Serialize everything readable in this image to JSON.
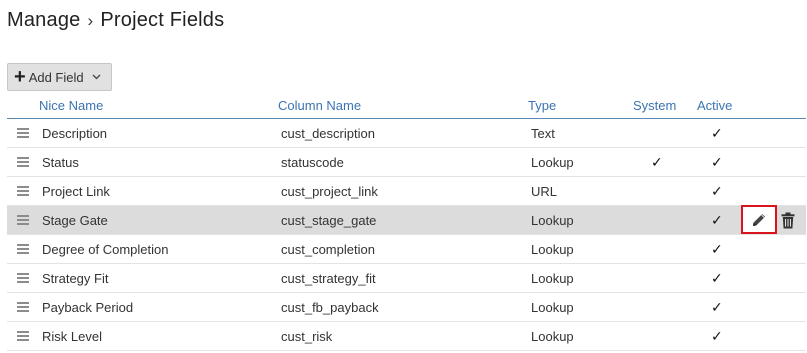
{
  "breadcrumb": {
    "parent": "Manage",
    "separator": "›",
    "current": "Project Fields"
  },
  "toolbar": {
    "add_label": "Add Field"
  },
  "table": {
    "headers": {
      "nice_name": "Nice Name",
      "column_name": "Column Name",
      "type": "Type",
      "system": "System",
      "active": "Active"
    },
    "check_glyph": "✓",
    "rows": [
      {
        "nice_name": "Description",
        "column_name": "cust_description",
        "type": "Text",
        "system": "",
        "active": "✓"
      },
      {
        "nice_name": "Status",
        "column_name": "statuscode",
        "type": "Lookup",
        "system": "✓",
        "active": "✓"
      },
      {
        "nice_name": "Project Link",
        "column_name": "cust_project_link",
        "type": "URL",
        "system": "",
        "active": "✓"
      },
      {
        "nice_name": "Stage Gate",
        "column_name": "cust_stage_gate",
        "type": "Lookup",
        "system": "",
        "active": "✓"
      },
      {
        "nice_name": "Degree of Completion",
        "column_name": "cust_completion",
        "type": "Lookup",
        "system": "",
        "active": "✓"
      },
      {
        "nice_name": "Strategy Fit",
        "column_name": "cust_strategy_fit",
        "type": "Lookup",
        "system": "",
        "active": "✓"
      },
      {
        "nice_name": "Payback Period",
        "column_name": "cust_fb_payback",
        "type": "Lookup",
        "system": "",
        "active": "✓"
      },
      {
        "nice_name": "Risk Level",
        "column_name": "cust_risk",
        "type": "Lookup",
        "system": "",
        "active": "✓"
      }
    ]
  },
  "colors": {
    "header_text": "#3b73b1",
    "header_rule": "#5b8ab8",
    "selected_row": "#dcdcdc",
    "edit_highlight": "#d8141c"
  },
  "icons": {
    "drag": "drag-handle-icon",
    "edit": "pencil-icon",
    "delete": "trash-icon",
    "add": "plus-icon",
    "dropdown": "chevron-down-icon"
  }
}
